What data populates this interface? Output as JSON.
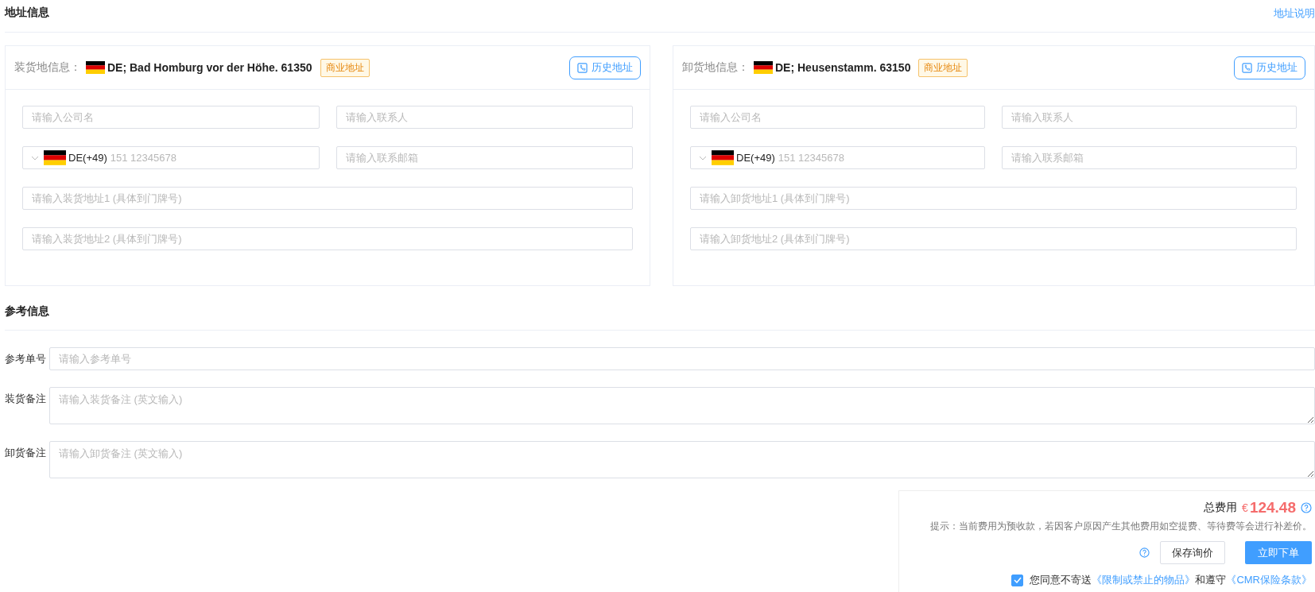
{
  "address_section": {
    "title": "地址信息",
    "link": "地址说明"
  },
  "cards": [
    {
      "label": "装货地信息：",
      "address": "DE; Bad Homburg vor der Höhe. 61350",
      "tag": "商业地址",
      "history_button": "历史地址",
      "fields": [
        {
          "kind": "text",
          "placeholder": "请输入公司名"
        },
        {
          "kind": "text",
          "placeholder": "请输入联系人"
        },
        {
          "kind": "phone",
          "code": "DE(+49)",
          "placeholder": "151 12345678"
        },
        {
          "kind": "text",
          "placeholder": "请输入联系邮箱"
        },
        {
          "kind": "wide",
          "placeholder": "请输入装货地址1 (具体到门牌号)"
        },
        {
          "kind": "wide",
          "placeholder": "请输入装货地址2 (具体到门牌号)"
        }
      ]
    },
    {
      "label": "卸货地信息：",
      "address": "DE; Heusenstamm. 63150",
      "tag": "商业地址",
      "history_button": "历史地址",
      "fields": [
        {
          "kind": "text",
          "placeholder": "请输入公司名"
        },
        {
          "kind": "text",
          "placeholder": "请输入联系人"
        },
        {
          "kind": "phone",
          "code": "DE(+49)",
          "placeholder": "151 12345678"
        },
        {
          "kind": "text",
          "placeholder": "请输入联系邮箱"
        },
        {
          "kind": "wide",
          "placeholder": "请输入卸货地址1 (具体到门牌号)"
        },
        {
          "kind": "wide",
          "placeholder": "请输入卸货地址2 (具体到门牌号)"
        }
      ]
    }
  ],
  "reference_section": {
    "title": "参考信息",
    "rows": [
      {
        "kind": "input",
        "label": "参考单号",
        "placeholder": "请输入参考单号"
      },
      {
        "kind": "textarea",
        "label": "装货备注",
        "placeholder": "请输入装货备注 (英文输入)"
      },
      {
        "kind": "textarea",
        "label": "卸货备注",
        "placeholder": "请输入卸货备注 (英文输入)"
      }
    ]
  },
  "summary": {
    "total_label": "总费用",
    "currency": "€",
    "amount": "124.48",
    "tip": "提示：当前费用为预收款，若因客户原因产生其他费用如空提费、等待费等会进行补差价。",
    "save_button": "保存询价",
    "order_button": "立即下单",
    "agreement": {
      "checked": true,
      "text": "您同意不寄送",
      "link_1": "《限制或禁止的物品》",
      "middle": "和遵守",
      "link_2": "《CMR保险条款》"
    }
  }
}
